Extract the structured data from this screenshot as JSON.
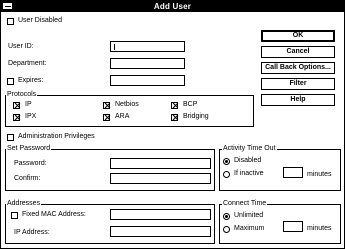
{
  "window": {
    "title": "Add User"
  },
  "user_disabled": {
    "label": "User Disabled",
    "checked": false
  },
  "user_id": {
    "label": "User ID:",
    "value": ""
  },
  "department": {
    "label": "Department:",
    "value": ""
  },
  "expires": {
    "label": "Expires:",
    "checked": false,
    "value": ""
  },
  "buttons": {
    "ok": "OK",
    "cancel": "Cancel",
    "call_back": "Call Back Options...",
    "filter": "Filter",
    "help": "Help"
  },
  "protocols": {
    "title": "Protocols",
    "items": [
      {
        "label": "IP",
        "checked": true
      },
      {
        "label": "IPX",
        "checked": true
      },
      {
        "label": "Netbios",
        "checked": true
      },
      {
        "label": "ARA",
        "checked": true
      },
      {
        "label": "BCP",
        "checked": true
      },
      {
        "label": "Bridging",
        "checked": true
      }
    ]
  },
  "admin_privileges": {
    "label": "Administration Privileges",
    "checked": false
  },
  "set_password": {
    "title": "Set Password",
    "password_label": "Password:",
    "confirm_label": "Confirm:"
  },
  "activity_timeout": {
    "title": "Activity Time Out",
    "disabled_label": "Disabled",
    "if_inactive_label": "If inactive",
    "minutes_label": "minutes",
    "selected": "Disabled"
  },
  "addresses": {
    "title": "Addresses",
    "fixed_mac_label": "Fixed MAC Address:",
    "fixed_mac_checked": false,
    "ip_label": "IP Address:"
  },
  "connect_time": {
    "title": "Connect Time",
    "unlimited_label": "Unlimited",
    "maximum_label": "Maximum",
    "minutes_label": "minutes",
    "selected": "Unlimited"
  }
}
